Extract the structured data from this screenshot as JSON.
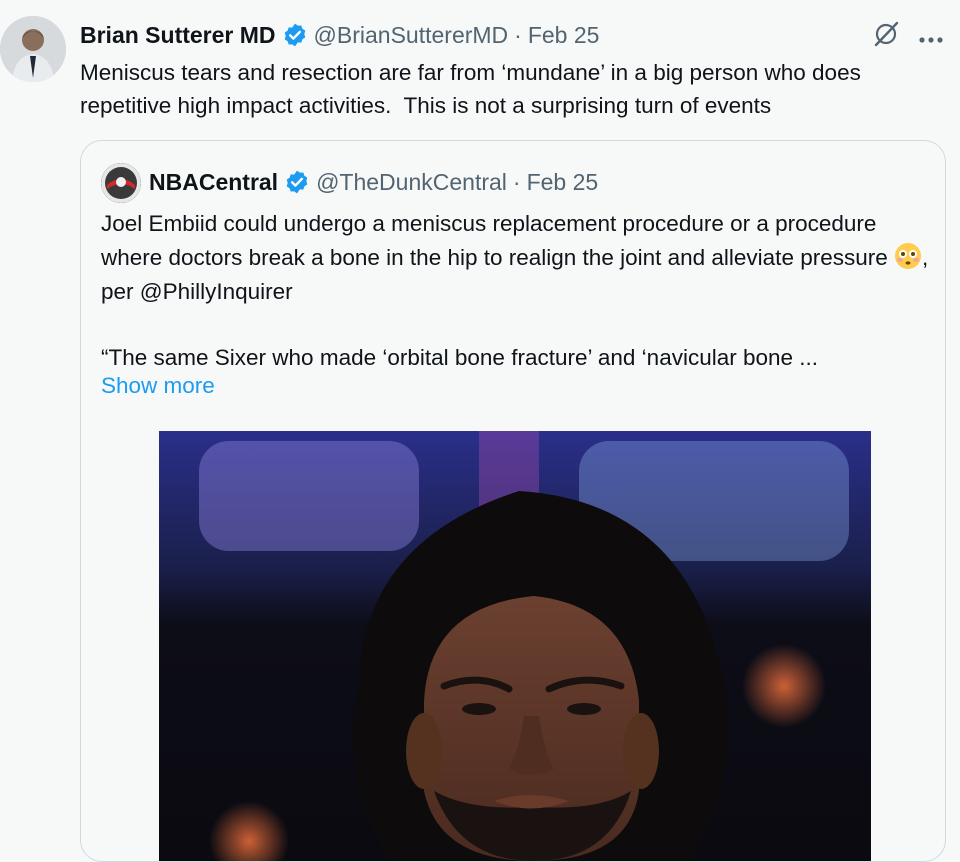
{
  "tweet": {
    "author_name": "Brian Sutterer MD",
    "author_handle": "@BrianSuttererMD",
    "separator": "·",
    "date": "Feb 25",
    "text": "Meniscus tears and resection are far from ‘mundane’ in a big person who does repetitive high impact activities.  This is not a surprising turn of events",
    "icons": {
      "grok": "grok-icon",
      "more": "more-icon"
    }
  },
  "quote": {
    "author_name": "NBACentral",
    "author_handle": "@TheDunkCentral",
    "separator": "·",
    "date": "Feb 25",
    "text_part1": "Joel Embiid could undergo a meniscus replacement procedure or a procedure where doctors break a bone in the hip to realign the joint and alleviate pressure ",
    "text_part2": ", per ",
    "mention": "@PhillyInquirer",
    "text_para2": "“The same Sixer who made ‘orbital bone fracture’ and ‘navicular bone ...",
    "show_more": "Show more",
    "emoji": "flushed-face"
  },
  "colors": {
    "link": "#1d9bf0",
    "verified": "#1d9bf0",
    "secondary_text": "#536471",
    "border": "#cfd9de"
  }
}
